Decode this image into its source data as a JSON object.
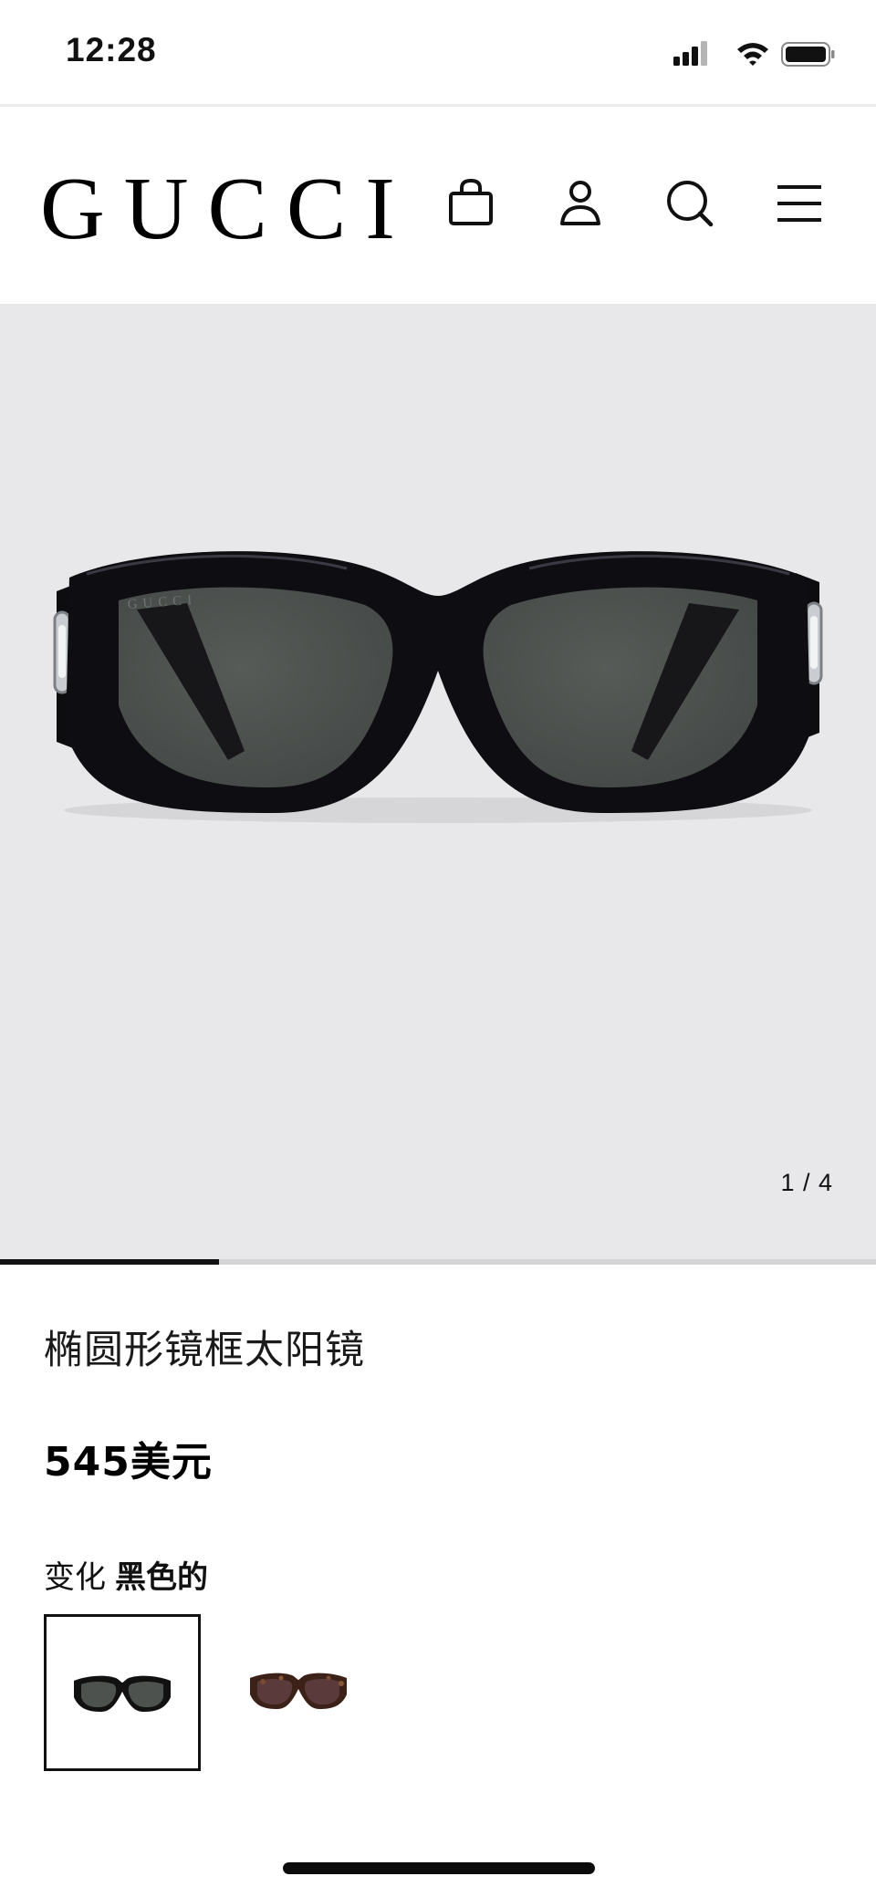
{
  "status_bar": {
    "time": "12:28"
  },
  "header": {
    "logo": "GUCCI",
    "icons": [
      "shopping-bag-icon",
      "account-icon",
      "search-icon",
      "menu-icon"
    ]
  },
  "gallery": {
    "counter": "1 / 4",
    "current_index": 1,
    "total": 4,
    "progress_fraction": 0.25,
    "lens_engraving": "GUCCI"
  },
  "product": {
    "title": "椭圆形镜框太阳镜",
    "price": "545美元"
  },
  "variants": {
    "label": "变化",
    "selected_value": "黑色的",
    "options": [
      {
        "name": "black",
        "frame_color": "#111111",
        "lens_color": "#4e524f",
        "selected": true
      },
      {
        "name": "tortoise",
        "frame_color": "#3b2117",
        "lens_color": "#5a3a3a",
        "selected": false
      }
    ]
  },
  "colors": {
    "hero_background": "#e8e8ea",
    "accent": "#111111"
  }
}
